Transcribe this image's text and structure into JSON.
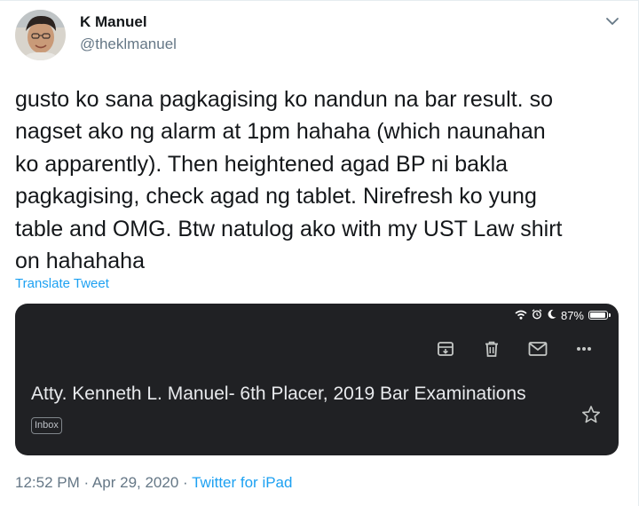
{
  "tweet": {
    "author": {
      "display_name": "K Manuel",
      "handle": "@theklmanuel",
      "avatar_icon": "user-avatar"
    },
    "text": "gusto ko sana pagkagising ko nandun na bar result. so\nnagset ako ng alarm at 1pm hahaha (which naunahan\nko apparently). Then heightened agad BP ni bakla\npagkagising, check agad ng tablet. Nirefresh ko yung\ntable and OMG. Btw natulog ako with my UST Law shirt\non hahahaha",
    "translate_label": "Translate Tweet",
    "timestamp": "12:52 PM · Apr 29, 2020 · ",
    "source": "Twitter for iPad",
    "more_icon": "chevron-down-icon"
  },
  "media": {
    "status_bar": {
      "battery_label": "87%",
      "battery_level": 0.87,
      "icons": [
        "wifi-icon",
        "alarm-icon",
        "moon-icon",
        "battery-icon"
      ]
    },
    "actions": [
      "archive-icon",
      "delete-icon",
      "mark-unread-icon",
      "more-icon"
    ],
    "email_subject": "Atty. Kenneth L. Manuel- 6th Placer, 2019 Bar Examinations",
    "label_badge": "Inbox",
    "star_icon": "star-icon"
  },
  "colors": {
    "text": "#14171a",
    "secondary": "#657786",
    "link": "#1da1f2",
    "media_bg": "#202124"
  }
}
